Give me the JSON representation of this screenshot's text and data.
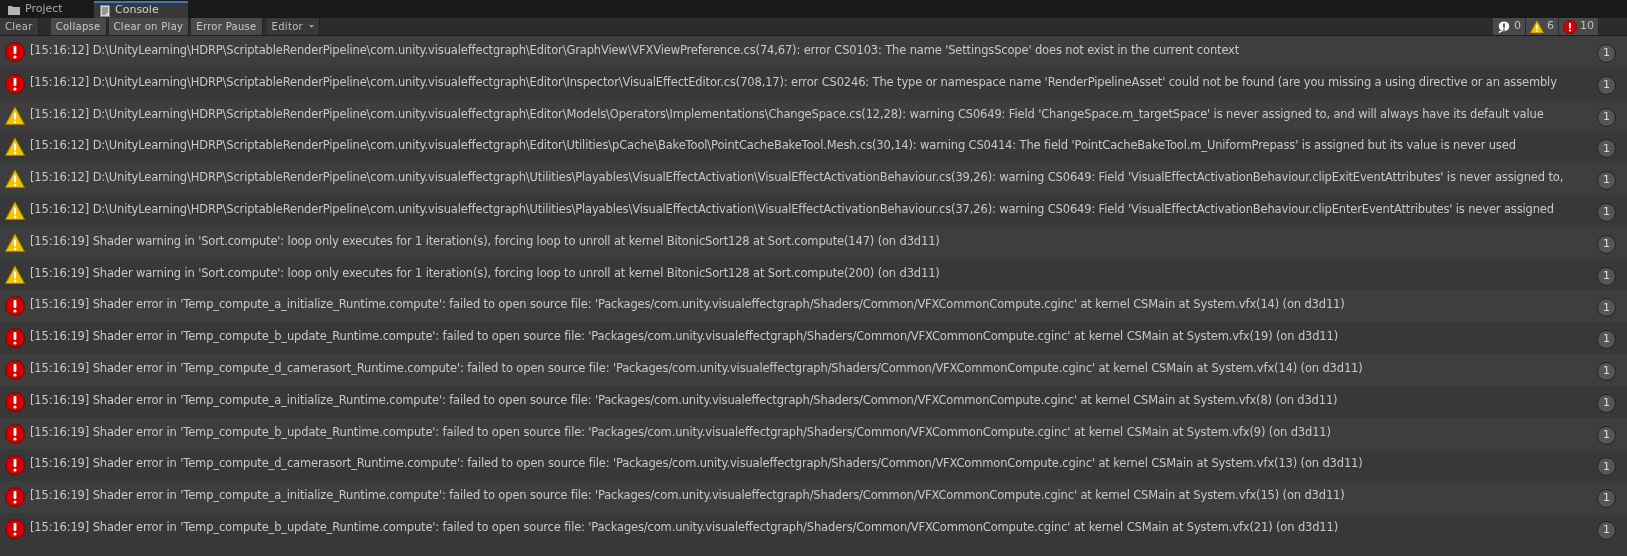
{
  "tabs": [
    {
      "label": "Project",
      "kind": "folder",
      "selected": false
    },
    {
      "label": "Console",
      "kind": "document",
      "selected": true
    }
  ],
  "toolbar": {
    "buttons": [
      {
        "label": "Clear",
        "kind": "button",
        "on": false
      },
      {
        "label": "Collapse",
        "kind": "toggle",
        "on": true
      },
      {
        "label": "Clear on Play",
        "kind": "toggle",
        "on": true
      },
      {
        "label": "Error Pause",
        "kind": "toggle",
        "on": true
      },
      {
        "label": "Editor",
        "kind": "dropdown",
        "on": false
      }
    ],
    "filters": [
      {
        "kind": "info",
        "count": "0"
      },
      {
        "kind": "warning",
        "count": "6"
      },
      {
        "kind": "error",
        "count": "10"
      }
    ]
  },
  "entries": [
    {
      "kind": "error",
      "text": "[15:16:12] D:\\UnityLearning\\HDRP\\ScriptableRenderPipeline\\com.unity.visualeffectgraph\\Editor\\GraphView\\VFXViewPreference.cs(74,67): error CS0103: The name 'SettingsScope' does not exist in the current context",
      "count": "1"
    },
    {
      "kind": "error",
      "text": "[15:16:12] D:\\UnityLearning\\HDRP\\ScriptableRenderPipeline\\com.unity.visualeffectgraph\\Editor\\Inspector\\VisualEffectEditor.cs(708,17): error CS0246: The type or namespace name 'RenderPipelineAsset' could not be found (are you missing a using directive or an assembly",
      "count": "1"
    },
    {
      "kind": "warning",
      "text": "[15:16:12] D:\\UnityLearning\\HDRP\\ScriptableRenderPipeline\\com.unity.visualeffectgraph\\Editor\\Models\\Operators\\Implementations\\ChangeSpace.cs(12,28): warning CS0649: Field 'ChangeSpace.m_targetSpace' is never assigned to, and will always have its default value",
      "count": "1"
    },
    {
      "kind": "warning",
      "text": "[15:16:12] D:\\UnityLearning\\HDRP\\ScriptableRenderPipeline\\com.unity.visualeffectgraph\\Editor\\Utilities\\pCache\\BakeTool\\PointCacheBakeTool.Mesh.cs(30,14): warning CS0414: The field 'PointCacheBakeTool.m_UniformPrepass' is assigned but its value is never used",
      "count": "1"
    },
    {
      "kind": "warning",
      "text": "[15:16:12] D:\\UnityLearning\\HDRP\\ScriptableRenderPipeline\\com.unity.visualeffectgraph\\Utilities\\Playables\\VisualEffectActivation\\VisualEffectActivationBehaviour.cs(39,26): warning CS0649: Field 'VisualEffectActivationBehaviour.clipExitEventAttributes' is never assigned to,",
      "count": "1"
    },
    {
      "kind": "warning",
      "text": "[15:16:12] D:\\UnityLearning\\HDRP\\ScriptableRenderPipeline\\com.unity.visualeffectgraph\\Utilities\\Playables\\VisualEffectActivation\\VisualEffectActivationBehaviour.cs(37,26): warning CS0649: Field 'VisualEffectActivationBehaviour.clipEnterEventAttributes' is never assigned",
      "count": "1"
    },
    {
      "kind": "warning",
      "text": "[15:16:19] Shader warning in 'Sort.compute': loop only executes for 1 iteration(s), forcing loop to unroll at kernel BitonicSort128 at Sort.compute(147) (on d3d11)",
      "count": "1"
    },
    {
      "kind": "warning",
      "text": "[15:16:19] Shader warning in 'Sort.compute': loop only executes for 1 iteration(s), forcing loop to unroll at kernel BitonicSort128 at Sort.compute(200) (on d3d11)",
      "count": "1"
    },
    {
      "kind": "error",
      "text": "[15:16:19] Shader error in 'Temp_compute_a_initialize_Runtime.compute': failed to open source file: 'Packages/com.unity.visualeffectgraph/Shaders/Common/VFXCommonCompute.cginc' at kernel CSMain at System.vfx(14) (on d3d11)",
      "count": "1"
    },
    {
      "kind": "error",
      "text": "[15:16:19] Shader error in 'Temp_compute_b_update_Runtime.compute': failed to open source file: 'Packages/com.unity.visualeffectgraph/Shaders/Common/VFXCommonCompute.cginc' at kernel CSMain at System.vfx(19) (on d3d11)",
      "count": "1"
    },
    {
      "kind": "error",
      "text": "[15:16:19] Shader error in 'Temp_compute_d_camerasort_Runtime.compute': failed to open source file: 'Packages/com.unity.visualeffectgraph/Shaders/Common/VFXCommonCompute.cginc' at kernel CSMain at System.vfx(14) (on d3d11)",
      "count": "1"
    },
    {
      "kind": "error",
      "text": "[15:16:19] Shader error in 'Temp_compute_a_initialize_Runtime.compute': failed to open source file: 'Packages/com.unity.visualeffectgraph/Shaders/Common/VFXCommonCompute.cginc' at kernel CSMain at System.vfx(8) (on d3d11)",
      "count": "1"
    },
    {
      "kind": "error",
      "text": "[15:16:19] Shader error in 'Temp_compute_b_update_Runtime.compute': failed to open source file: 'Packages/com.unity.visualeffectgraph/Shaders/Common/VFXCommonCompute.cginc' at kernel CSMain at System.vfx(9) (on d3d11)",
      "count": "1"
    },
    {
      "kind": "error",
      "text": "[15:16:19] Shader error in 'Temp_compute_d_camerasort_Runtime.compute': failed to open source file: 'Packages/com.unity.visualeffectgraph/Shaders/Common/VFXCommonCompute.cginc' at kernel CSMain at System.vfx(13) (on d3d11)",
      "count": "1"
    },
    {
      "kind": "error",
      "text": "[15:16:19] Shader error in 'Temp_compute_a_initialize_Runtime.compute': failed to open source file: 'Packages/com.unity.visualeffectgraph/Shaders/Common/VFXCommonCompute.cginc' at kernel CSMain at System.vfx(15) (on d3d11)",
      "count": "1"
    },
    {
      "kind": "error",
      "text": "[15:16:19] Shader error in 'Temp_compute_b_update_Runtime.compute': failed to open source file: 'Packages/com.unity.visualeffectgraph/Shaders/Common/VFXCommonCompute.cginc' at kernel CSMain at System.vfx(21) (on d3d11)",
      "count": "1"
    }
  ]
}
